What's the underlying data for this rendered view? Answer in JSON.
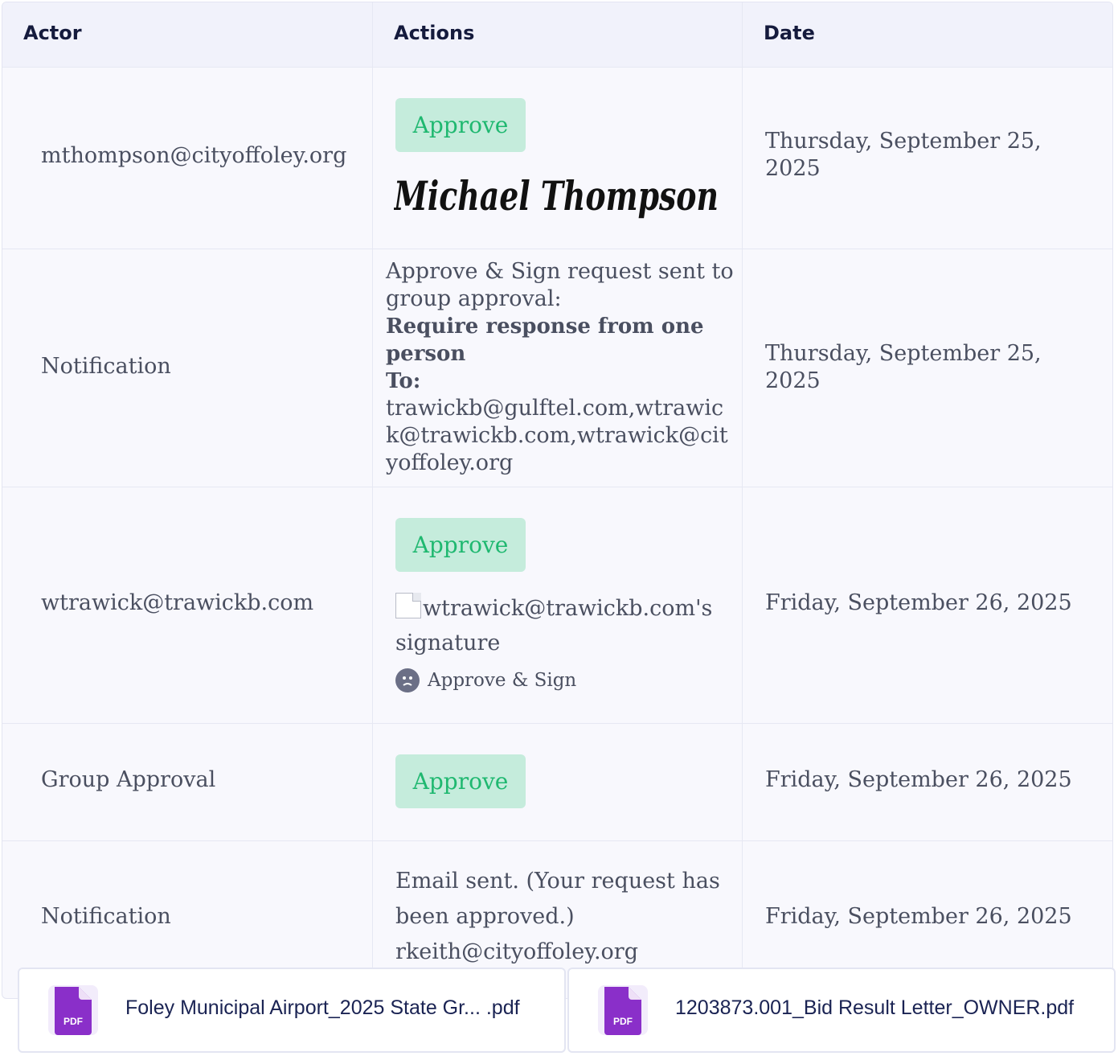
{
  "table": {
    "headers": {
      "actor": "Actor",
      "actions": "Actions",
      "date": "Date"
    },
    "rows": [
      {
        "actor": "mthompson@cityoffoley.org",
        "approve_label": "Approve",
        "signature_text": "Michael Thompson",
        "date": [
          "Thursday, September 25,",
          "2025"
        ]
      },
      {
        "actor": "Notification",
        "lines": [
          "Approve & Sign request sent to",
          "group approval:"
        ],
        "bold_lines": [
          "Require response from one",
          "person"
        ],
        "to_label": "To:",
        "recipients": [
          "trawickb@gulftel.com,wtrawic",
          "k@trawickb.com,wtrawick@cit",
          "yoffoley.org"
        ],
        "date": [
          "Thursday, September 25,",
          "2025"
        ]
      },
      {
        "actor": "wtrawick@trawickb.com",
        "approve_label": "Approve",
        "signature_alt": [
          "wtrawick@trawickb.com's",
          "signature"
        ],
        "meta_label": "Approve & Sign",
        "date": "Friday, September 26, 2025"
      },
      {
        "actor": "Group Approval",
        "approve_label": "Approve",
        "date": "Friday, September 26, 2025"
      },
      {
        "actor": "Notification",
        "lines": [
          "Email sent. (Your request has",
          "been approved.)",
          "rkeith@cityoffoley.org"
        ],
        "date": "Friday, September 26, 2025"
      }
    ]
  },
  "files": [
    {
      "name": "Foley Municipal Airport_2025 State Gr... .pdf",
      "badge": "PDF"
    },
    {
      "name": "1203873.001_Bid Result Letter_OWNER.pdf",
      "badge": "PDF"
    }
  ],
  "colors": {
    "accent": "#1fb870",
    "approve_bg": "#c5ecdc",
    "pdf": "#8a2fc9",
    "header_text": "#151b3d"
  }
}
